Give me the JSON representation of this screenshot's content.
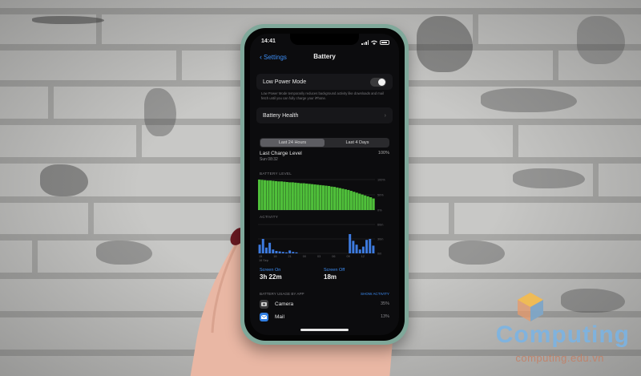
{
  "status_bar": {
    "time": "14:41"
  },
  "nav": {
    "back_label": "Settings",
    "title": "Battery"
  },
  "low_power": {
    "label": "Low Power Mode",
    "enabled": false,
    "note": "Low Power Mode temporarily reduces background activity like downloads and mail fetch until you can fully charge your iPhone."
  },
  "battery_health": {
    "label": "Battery Health"
  },
  "range_tabs": [
    {
      "label": "Last 24 Hours",
      "selected": true
    },
    {
      "label": "Last 4 Days",
      "selected": false
    }
  ],
  "last_charge": {
    "label": "Last Charge Level",
    "time": "Sun 08:32",
    "value": "100%"
  },
  "battery_level_label": "BATTERY LEVEL",
  "activity_label": "ACTIVITY",
  "chart_data": [
    {
      "type": "area",
      "title": "BATTERY LEVEL",
      "y_tick_labels": [
        "100%",
        "50%",
        "0%"
      ],
      "ylim": [
        0,
        100
      ],
      "values": [
        100,
        99,
        98,
        97,
        97,
        96,
        95,
        94,
        94,
        93,
        92,
        91,
        91,
        90,
        89,
        88,
        88,
        87,
        86,
        85,
        84,
        83,
        82,
        81,
        80,
        79,
        77,
        76,
        74,
        72,
        70,
        68,
        66,
        63,
        60,
        57,
        54,
        51,
        48,
        45,
        42,
        38
      ],
      "color": "#4fbf3a"
    },
    {
      "type": "bar",
      "title": "ACTIVITY",
      "x_tick_labels": [
        "15",
        "18",
        "21",
        "00",
        "03",
        "06",
        "09",
        "12"
      ],
      "y_tick_labels": [
        "60m",
        "30m",
        "0m"
      ],
      "date_label": "16 Sep",
      "ylim": [
        0,
        60
      ],
      "values": [
        18,
        30,
        12,
        22,
        8,
        5,
        4,
        3,
        2,
        6,
        3,
        2,
        0,
        0,
        0,
        0,
        0,
        0,
        0,
        0,
        0,
        0,
        0,
        0,
        0,
        0,
        0,
        40,
        26,
        18,
        8,
        14,
        28,
        30,
        16
      ],
      "color": "#3d7be0"
    }
  ],
  "screen_on": {
    "label": "Screen On",
    "value": "3h 22m"
  },
  "screen_off": {
    "label": "Screen Off",
    "value": "18m"
  },
  "usage": {
    "header": "BATTERY USAGE BY APP",
    "action": "SHOW ACTIVITY",
    "apps": [
      {
        "name": "Camera",
        "percent": "35%",
        "color": "#3a3a3c"
      },
      {
        "name": "Mail",
        "percent": "13%",
        "color": "#2f7de1"
      }
    ]
  },
  "watermark": {
    "brand": "Computing",
    "url": "computing.edu.vn"
  },
  "colors": {
    "accent": "#3d8ef5",
    "battery_green": "#4fbf3a",
    "phone_green": "#7fa89a"
  }
}
